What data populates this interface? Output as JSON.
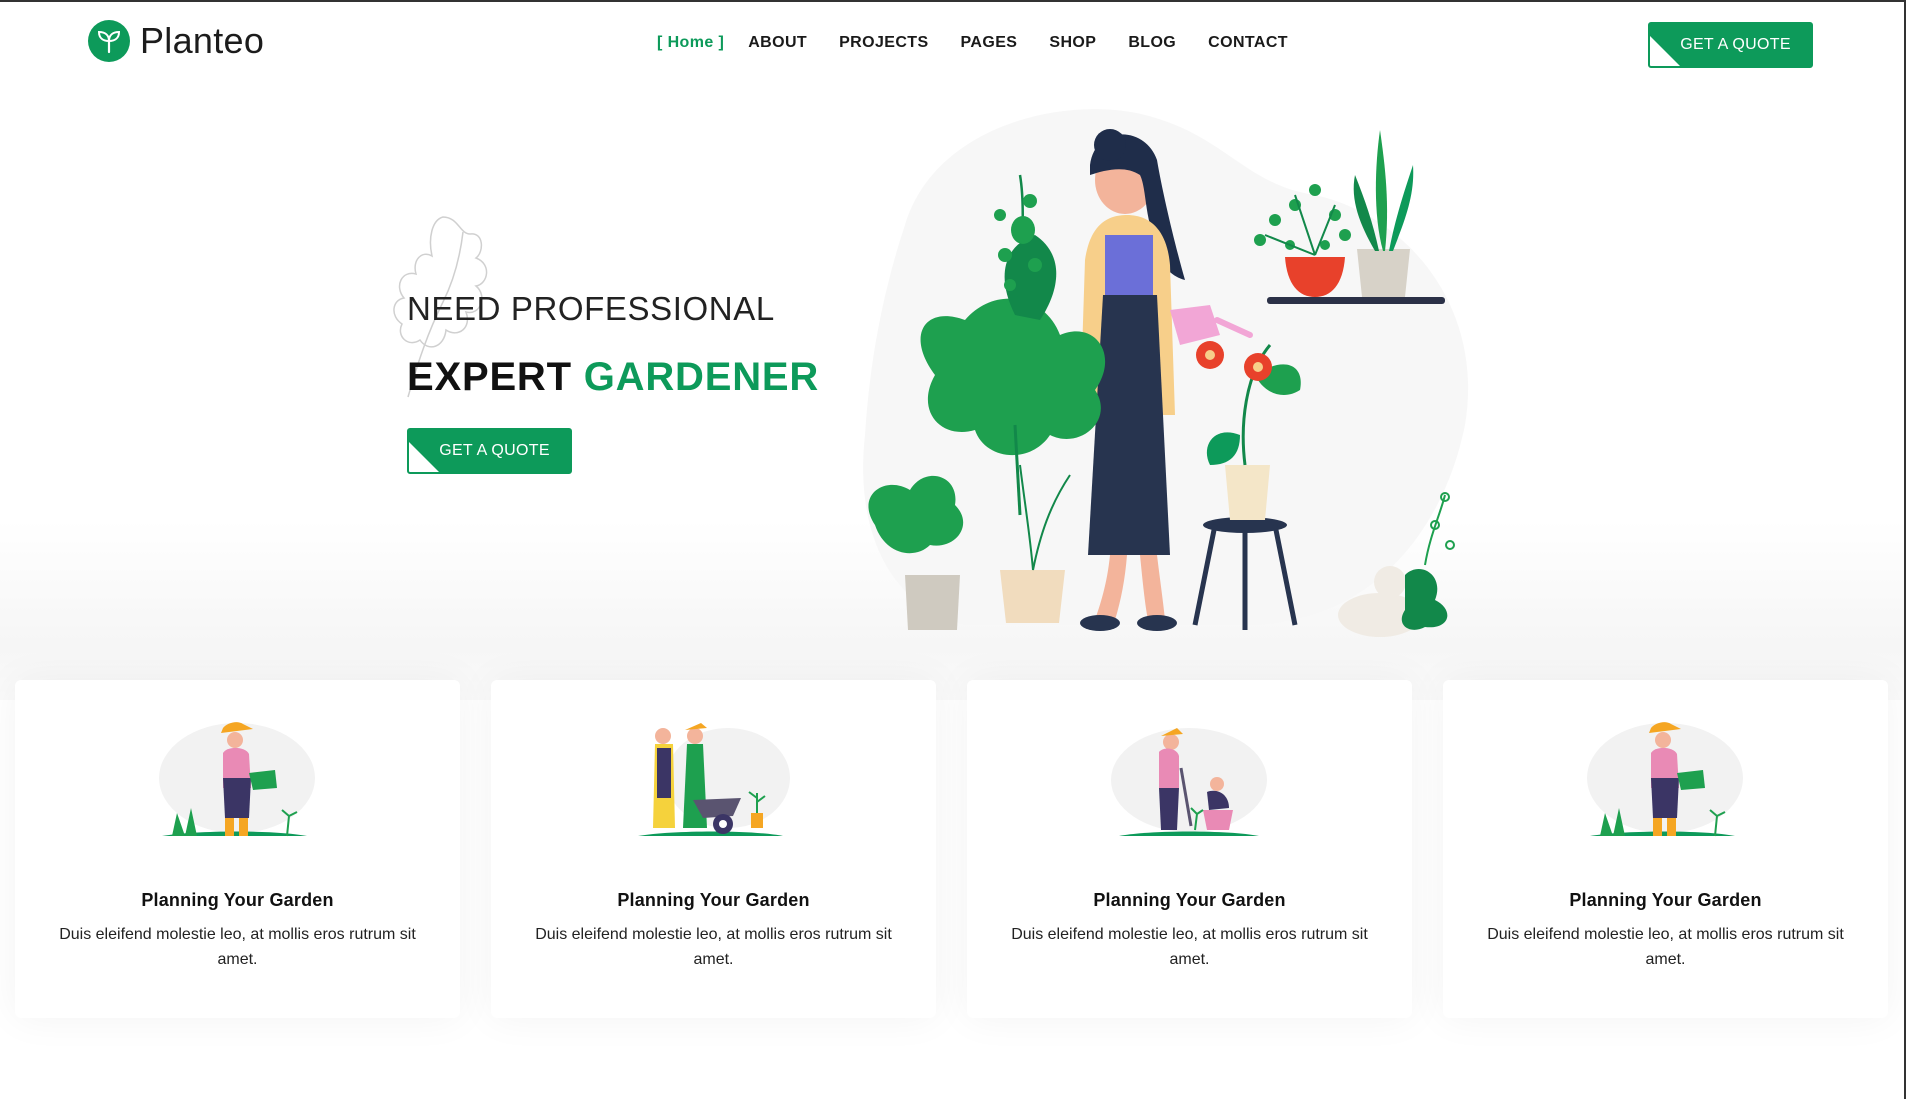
{
  "brand": {
    "name": "Planteo",
    "color": "#0d9a5a",
    "icon": "sprout-icon"
  },
  "nav": {
    "items": [
      {
        "label": "[ Home ]",
        "active": true
      },
      {
        "label": "ABOUT",
        "active": false
      },
      {
        "label": "PROJECTS",
        "active": false
      },
      {
        "label": "PAGES",
        "active": false
      },
      {
        "label": "SHOP",
        "active": false
      },
      {
        "label": "BLOG",
        "active": false
      },
      {
        "label": "CONTACT",
        "active": false
      }
    ],
    "cta_label": "GET A QUOTE"
  },
  "hero": {
    "subtitle": "NEED PROFESSIONAL",
    "title_part1": "EXPERT",
    "title_part2": "GARDENER",
    "cta_label": "GET A QUOTE",
    "illustration": "woman-watering-plants-illustration"
  },
  "cards": [
    {
      "title": "Planning Your Garden",
      "text": "Duis eleifend molestie leo, at mollis eros rutrum sit amet.",
      "illustration": "gardener-watering-illustration"
    },
    {
      "title": "Planning Your Garden",
      "text": "Duis eleifend molestie leo, at mollis eros rutrum sit amet.",
      "illustration": "couple-wheelbarrow-illustration"
    },
    {
      "title": "Planning Your Garden",
      "text": "Duis eleifend molestie leo, at mollis eros rutrum sit amet.",
      "illustration": "gardeners-planting-illustration"
    },
    {
      "title": "Planning Your Garden",
      "text": "Duis eleifend molestie leo, at mollis eros rutrum sit amet.",
      "illustration": "gardener-watering-illustration"
    }
  ]
}
